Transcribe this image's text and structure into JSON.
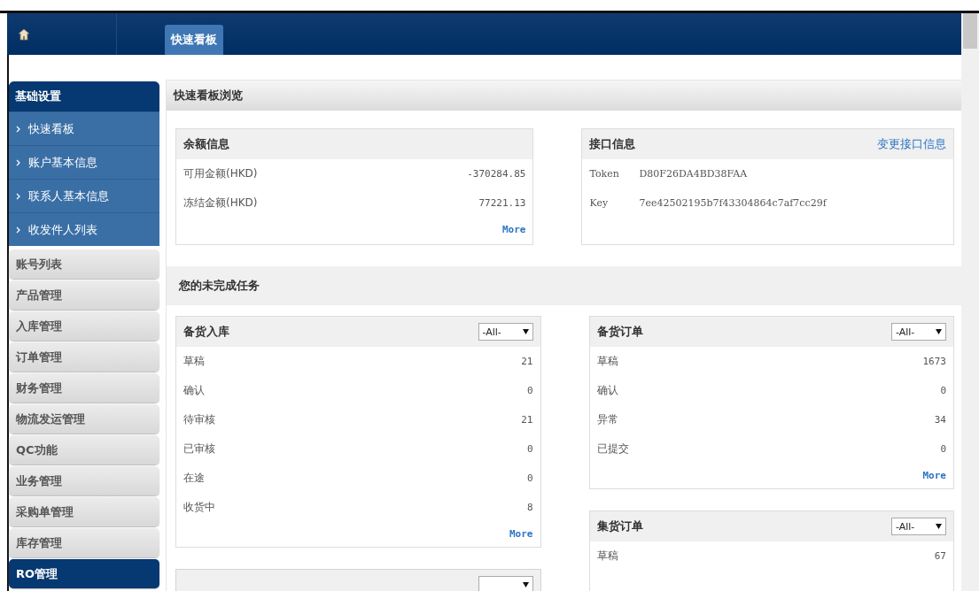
{
  "header": {
    "tabs": [
      {
        "label": "快速看板",
        "selected": true
      }
    ]
  },
  "sidebar": {
    "section": {
      "title": "基础设置",
      "items": [
        {
          "label": "快速看板",
          "selected": false
        },
        {
          "label": "账户基本信息",
          "selected": false
        },
        {
          "label": "联系人基本信息",
          "selected": false
        },
        {
          "label": "收发件人列表",
          "selected": false
        }
      ]
    },
    "menu": [
      {
        "label": "账号列表",
        "selected": false
      },
      {
        "label": "产品管理",
        "selected": false
      },
      {
        "label": "入库管理",
        "selected": false
      },
      {
        "label": "订单管理",
        "selected": false
      },
      {
        "label": "财务管理",
        "selected": false
      },
      {
        "label": "物流发运管理",
        "selected": false
      },
      {
        "label": "QC功能",
        "selected": false
      },
      {
        "label": "业务管理",
        "selected": false
      },
      {
        "label": "采购单管理",
        "selected": false
      },
      {
        "label": "库存管理",
        "selected": false
      },
      {
        "label": "RO管理",
        "selected": true
      }
    ]
  },
  "main": {
    "title": "快速看板浏览",
    "balance": {
      "title": "余额信息",
      "rows": [
        {
          "label": "可用金额(HKD)",
          "value": "-370284.85"
        },
        {
          "label": "冻结金额(HKD)",
          "value": "77221.13"
        }
      ],
      "more": "More"
    },
    "api": {
      "title": "接口信息",
      "action": "变更接口信息",
      "rows": [
        {
          "label": "Token",
          "value": "D80F26DA4BD38FAA"
        },
        {
          "label": "Key",
          "value": "7ee42502195b7f43304864c7af7cc29f"
        }
      ]
    },
    "tasks_title": "您的未完成任务",
    "left_panels": [
      {
        "title": "备货入库",
        "filter": "-All-",
        "rows": [
          {
            "label": "草稿",
            "value": "21"
          },
          {
            "label": "确认",
            "value": "0"
          },
          {
            "label": "待审核",
            "value": "21"
          },
          {
            "label": "已审核",
            "value": "0"
          },
          {
            "label": "在途",
            "value": "0"
          },
          {
            "label": "收货中",
            "value": "8"
          }
        ],
        "more": "More"
      },
      {
        "kind": "cut"
      }
    ],
    "right_panels": [
      {
        "title": "备货订单",
        "filter": "-All-",
        "rows": [
          {
            "label": "草稿",
            "value": "1673"
          },
          {
            "label": "确认",
            "value": "0"
          },
          {
            "label": "异常",
            "value": "34"
          },
          {
            "label": "已提交",
            "value": "0"
          }
        ],
        "more": "More"
      },
      {
        "title": "集货订单",
        "filter": "-All-",
        "rows": [
          {
            "label": "草稿",
            "value": "67"
          }
        ]
      }
    ]
  }
}
